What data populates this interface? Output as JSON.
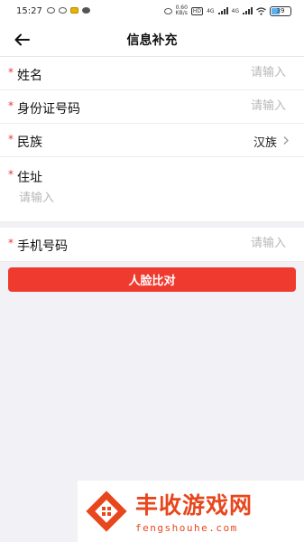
{
  "status_bar": {
    "time": "15:27",
    "net_speed": "0.60",
    "net_unit": "KB/s",
    "volte": "HD",
    "net_type_1": "4G",
    "net_type_2": "4G",
    "battery": "39"
  },
  "header": {
    "back_icon": "arrow-left-icon",
    "title": "信息补充"
  },
  "form": {
    "required_mark": "*",
    "name": {
      "label": "姓名",
      "placeholder": "请输入"
    },
    "id_number": {
      "label": "身份证号码",
      "placeholder": "请输入"
    },
    "ethnicity": {
      "label": "民族",
      "value": "汉族",
      "icon": "chevron-right-icon"
    },
    "address": {
      "label": "住址",
      "placeholder": "请输入"
    },
    "phone": {
      "label": "手机号码",
      "placeholder": "请输入"
    }
  },
  "submit_button": {
    "label": "人脸比对"
  },
  "watermark": {
    "title": "丰收游戏网",
    "subtitle": "fengshouhe.com"
  },
  "colors": {
    "accent": "#ef3b2f",
    "required": "#e53935",
    "background": "#f2f2f6",
    "watermark": "#e8461c"
  }
}
